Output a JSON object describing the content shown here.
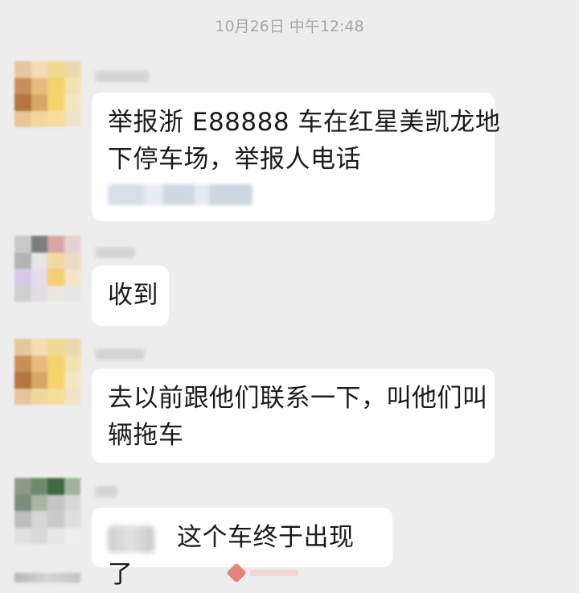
{
  "chat": {
    "timestamp": "10月26日 中午12:48",
    "messages": [
      {
        "id": "msg-1",
        "lines": [
          "举报浙 E88888 车在红星美凯龙地",
          "下停车场，举报人电话"
        ],
        "redacted": "phone"
      },
      {
        "id": "msg-2",
        "lines": [
          "收到"
        ]
      },
      {
        "id": "msg-3",
        "lines": [
          "去以前跟他们联系一下，叫他们叫",
          "辆拖车"
        ]
      },
      {
        "id": "msg-4",
        "lines": [
          "这个车终于出现了"
        ],
        "redacted": "mention"
      }
    ]
  },
  "colors": {
    "background": "#ededed",
    "bubble": "#ffffff",
    "text": "#1b1b1b",
    "timestamp": "#a8a8a8"
  }
}
